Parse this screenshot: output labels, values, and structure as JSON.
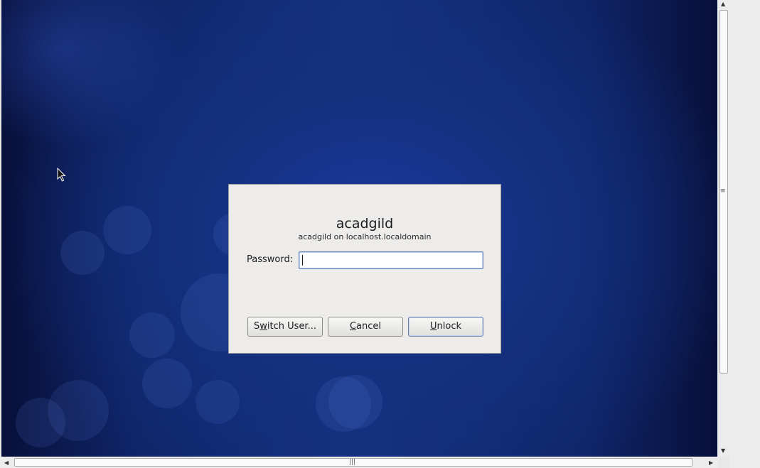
{
  "dialog": {
    "title": "acadgild",
    "subtitle": "acadgild on localhost.localdomain",
    "password_label": "Password:",
    "password_value": "",
    "buttons": {
      "switch_user": {
        "pre": "S",
        "mnemonic": "w",
        "post": "itch User..."
      },
      "cancel": {
        "pre": "",
        "mnemonic": "C",
        "post": "ancel"
      },
      "unlock": {
        "pre": "",
        "mnemonic": "U",
        "post": "nlock"
      }
    }
  },
  "scrollbars": {
    "up_arrow": "▲",
    "down_arrow": "▼",
    "left_arrow": "◀",
    "right_arrow": "▶",
    "grip_v": "≡",
    "grip_h": "|||"
  },
  "icons": {
    "cursor": "mouse-pointer-icon"
  }
}
